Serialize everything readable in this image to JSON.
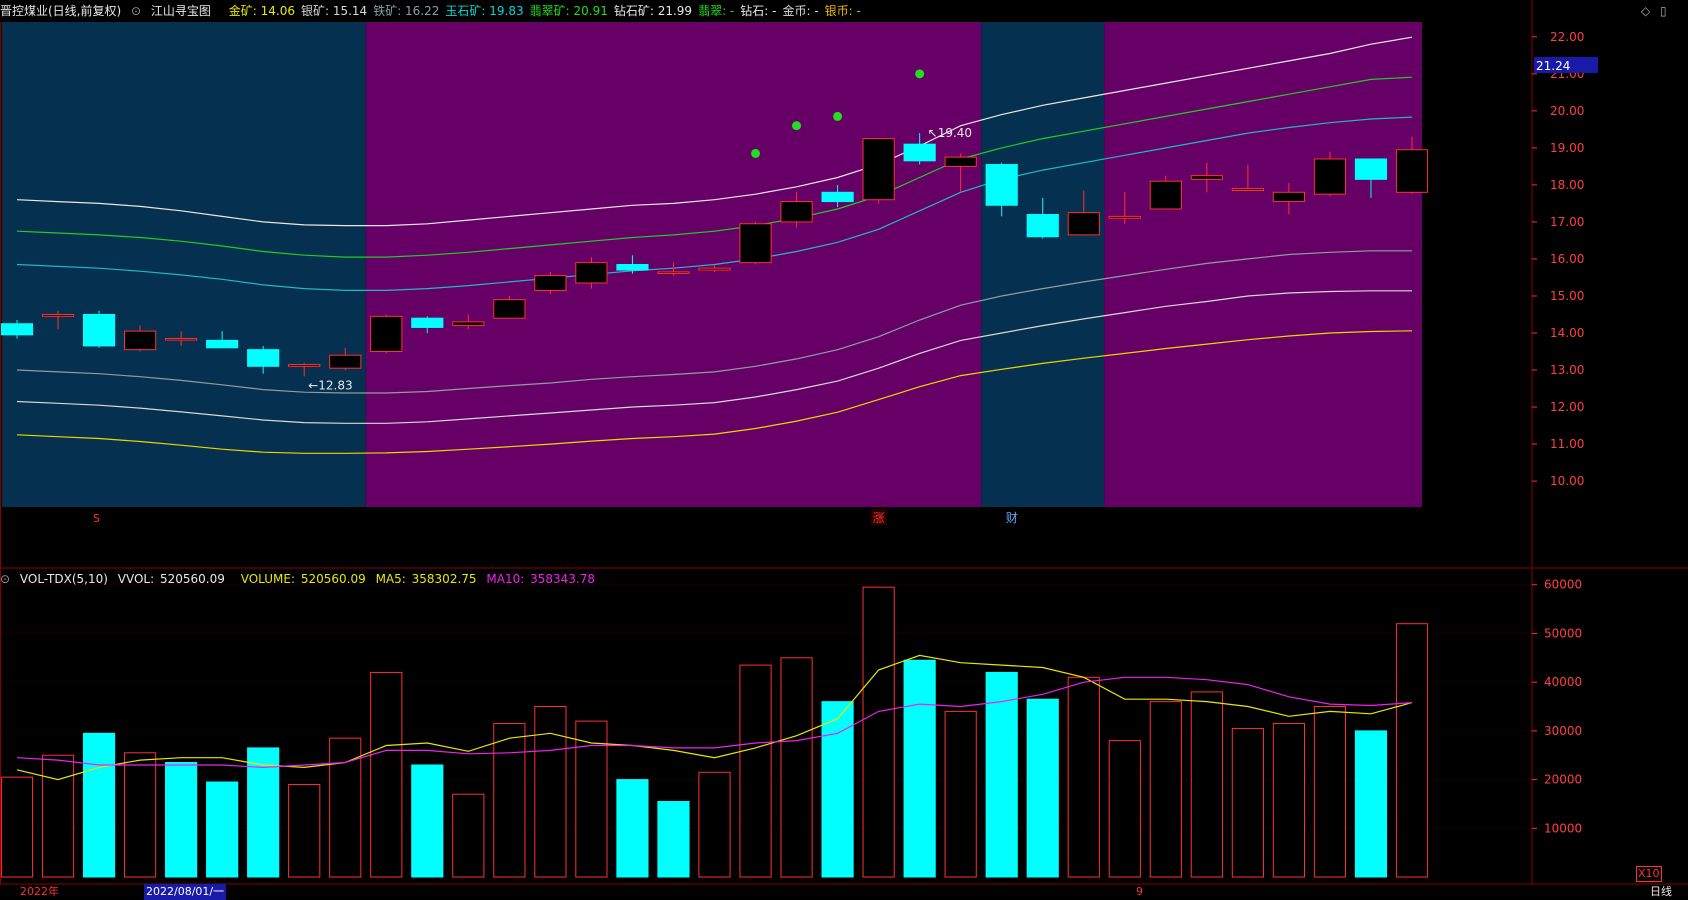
{
  "header": {
    "stock_name": "晋控煤业(日线,前复权)",
    "indicator_name": "江山寻宝图",
    "fields": [
      {
        "label": "金矿:",
        "value": "14.06",
        "color": "#e8e800"
      },
      {
        "label": "银矿:",
        "value": "15.14",
        "color": "#d8d8d8"
      },
      {
        "label": "铁矿:",
        "value": "16.22",
        "color": "#8aa0a0"
      },
      {
        "label": "玉石矿:",
        "value": "19.83",
        "color": "#00d8d8"
      },
      {
        "label": "翡翠矿:",
        "value": "20.91",
        "color": "#22dd22"
      },
      {
        "label": "钻石矿:",
        "value": "21.99",
        "color": "#e8e8e8"
      },
      {
        "label": "翡翠:",
        "value": "-",
        "color": "#22dd22"
      },
      {
        "label": "钻石:",
        "value": "-",
        "color": "#e8e8e8"
      },
      {
        "label": "金币:",
        "value": "-",
        "color": "#d8d8d8"
      },
      {
        "label": "银币:",
        "value": "-",
        "color": "#e8b800"
      }
    ]
  },
  "volume_header": {
    "indicator": "VOL-TDX(5,10)",
    "vvol_label": "VVOL:",
    "vvol_value": "520560.09",
    "volume_label": "VOLUME:",
    "volume_value": "520560.09",
    "ma5_label": "MA5:",
    "ma5_value": "358302.75",
    "ma10_label": "MA10:",
    "ma10_value": "358343.78"
  },
  "markers": {
    "low_label": "←12.83",
    "high_label": "↖19.40",
    "current_price_tag": "21.24",
    "event_s": "S",
    "event_zhang": "涨",
    "event_cai": "财"
  },
  "bottom": {
    "year": "2022年",
    "date_cursor": "2022/08/01/一",
    "month_mark": "9",
    "period": "日线",
    "zoom": "X10"
  },
  "colors": {
    "up": "#ff3030",
    "down": "#00ffff",
    "zone_blue": "#05304f",
    "zone_purple": "#660066",
    "axis_text": "#ff4040"
  },
  "chart_data": [
    {
      "type": "candlestick",
      "title": "晋控煤业(日线,前复权)",
      "y_axis_ticks": [
        "22.00",
        "21.00",
        "20.00",
        "19.00",
        "18.00",
        "17.00",
        "16.00",
        "15.00",
        "14.00",
        "13.00",
        "12.00",
        "11.00",
        "10.00"
      ],
      "ylim": [
        9.3,
        22.4
      ],
      "candles": [
        {
          "o": 14.25,
          "h": 14.35,
          "l": 13.85,
          "c": 13.95
        },
        {
          "o": 14.45,
          "h": 14.6,
          "l": 14.1,
          "c": 14.5
        },
        {
          "o": 14.5,
          "h": 14.6,
          "l": 13.6,
          "c": 13.65
        },
        {
          "o": 13.55,
          "h": 14.2,
          "l": 13.5,
          "c": 14.05
        },
        {
          "o": 13.85,
          "h": 14.05,
          "l": 13.65,
          "c": 13.85
        },
        {
          "o": 13.8,
          "h": 14.05,
          "l": 13.6,
          "c": 13.6
        },
        {
          "o": 13.55,
          "h": 13.65,
          "l": 12.9,
          "c": 13.1
        },
        {
          "o": 13.1,
          "h": 13.2,
          "l": 12.83,
          "c": 13.15
        },
        {
          "o": 13.05,
          "h": 13.6,
          "l": 13.0,
          "c": 13.4
        },
        {
          "o": 13.5,
          "h": 14.5,
          "l": 13.45,
          "c": 14.45
        },
        {
          "o": 14.4,
          "h": 14.45,
          "l": 14.0,
          "c": 14.15
        },
        {
          "o": 14.2,
          "h": 14.5,
          "l": 14.1,
          "c": 14.3
        },
        {
          "o": 14.4,
          "h": 15.0,
          "l": 14.4,
          "c": 14.9
        },
        {
          "o": 15.15,
          "h": 15.65,
          "l": 15.05,
          "c": 15.55
        },
        {
          "o": 15.35,
          "h": 16.05,
          "l": 15.2,
          "c": 15.9
        },
        {
          "o": 15.85,
          "h": 16.1,
          "l": 15.6,
          "c": 15.7
        },
        {
          "o": 15.65,
          "h": 15.9,
          "l": 15.55,
          "c": 15.65
        },
        {
          "o": 15.7,
          "h": 15.85,
          "l": 15.65,
          "c": 15.75
        },
        {
          "o": 15.9,
          "h": 17.0,
          "l": 15.85,
          "c": 16.95
        },
        {
          "o": 17.0,
          "h": 17.8,
          "l": 16.85,
          "c": 17.55
        },
        {
          "o": 17.8,
          "h": 18.0,
          "l": 17.4,
          "c": 17.55
        },
        {
          "o": 17.6,
          "h": 19.25,
          "l": 17.5,
          "c": 19.25
        },
        {
          "o": 19.1,
          "h": 19.4,
          "l": 18.55,
          "c": 18.65
        },
        {
          "o": 18.5,
          "h": 18.85,
          "l": 17.8,
          "c": 18.75
        },
        {
          "o": 18.55,
          "h": 18.6,
          "l": 17.15,
          "c": 17.45
        },
        {
          "o": 17.2,
          "h": 17.65,
          "l": 16.55,
          "c": 16.6
        },
        {
          "o": 16.65,
          "h": 17.85,
          "l": 16.65,
          "c": 17.25
        },
        {
          "o": 17.1,
          "h": 17.8,
          "l": 16.95,
          "c": 17.15
        },
        {
          "o": 17.35,
          "h": 18.25,
          "l": 17.35,
          "c": 18.1
        },
        {
          "o": 18.15,
          "h": 18.6,
          "l": 17.8,
          "c": 18.25
        },
        {
          "o": 17.85,
          "h": 18.55,
          "l": 17.85,
          "c": 17.9
        },
        {
          "o": 17.55,
          "h": 18.05,
          "l": 17.2,
          "c": 17.8
        },
        {
          "o": 17.75,
          "h": 18.9,
          "l": 17.7,
          "c": 18.7
        },
        {
          "o": 18.7,
          "h": 18.7,
          "l": 17.65,
          "c": 18.15
        },
        {
          "o": 17.8,
          "h": 19.3,
          "l": 17.75,
          "c": 18.95
        }
      ],
      "bands": [
        {
          "name": "钻石矿",
          "color": "#e8e8e8",
          "values": [
            17.6,
            17.55,
            17.5,
            17.42,
            17.3,
            17.15,
            17.0,
            16.92,
            16.9,
            16.9,
            16.95,
            17.05,
            17.15,
            17.25,
            17.35,
            17.45,
            17.5,
            17.6,
            17.75,
            17.95,
            18.2,
            18.55,
            19.05,
            19.6,
            19.9,
            20.15,
            20.35,
            20.55,
            20.75,
            20.95,
            21.15,
            21.35,
            21.55,
            21.8,
            21.99
          ]
        },
        {
          "name": "翡翠矿",
          "color": "#22cc22",
          "values": [
            16.75,
            16.7,
            16.65,
            16.58,
            16.48,
            16.35,
            16.2,
            16.1,
            16.05,
            16.05,
            16.1,
            16.18,
            16.28,
            16.38,
            16.48,
            16.58,
            16.65,
            16.75,
            16.9,
            17.1,
            17.35,
            17.7,
            18.2,
            18.7,
            19.0,
            19.25,
            19.45,
            19.65,
            19.85,
            20.05,
            20.25,
            20.45,
            20.65,
            20.85,
            20.91
          ]
        },
        {
          "name": "玉石矿",
          "color": "#20b8c8",
          "values": [
            15.85,
            15.8,
            15.75,
            15.67,
            15.57,
            15.45,
            15.3,
            15.2,
            15.15,
            15.15,
            15.2,
            15.28,
            15.38,
            15.48,
            15.58,
            15.68,
            15.75,
            15.85,
            16.0,
            16.2,
            16.45,
            16.8,
            17.3,
            17.8,
            18.15,
            18.4,
            18.6,
            18.8,
            19.0,
            19.2,
            19.4,
            19.55,
            19.68,
            19.78,
            19.83
          ]
        },
        {
          "name": "铁矿",
          "color": "#8aa0a0",
          "values": [
            13.0,
            12.95,
            12.9,
            12.82,
            12.72,
            12.6,
            12.47,
            12.4,
            12.38,
            12.38,
            12.42,
            12.5,
            12.58,
            12.65,
            12.75,
            12.82,
            12.88,
            12.95,
            13.1,
            13.3,
            13.55,
            13.9,
            14.35,
            14.75,
            15.0,
            15.2,
            15.38,
            15.55,
            15.72,
            15.88,
            16.0,
            16.12,
            16.18,
            16.22,
            16.22
          ]
        },
        {
          "name": "银矿",
          "color": "#d8d8d8",
          "values": [
            12.15,
            12.1,
            12.05,
            11.97,
            11.87,
            11.76,
            11.65,
            11.58,
            11.56,
            11.56,
            11.6,
            11.68,
            11.76,
            11.84,
            11.92,
            12.0,
            12.05,
            12.12,
            12.27,
            12.47,
            12.7,
            13.05,
            13.45,
            13.8,
            14.0,
            14.2,
            14.38,
            14.55,
            14.72,
            14.85,
            15.0,
            15.08,
            15.12,
            15.14,
            15.14
          ]
        },
        {
          "name": "金矿",
          "color": "#e8d800",
          "values": [
            11.25,
            11.2,
            11.15,
            11.07,
            10.97,
            10.86,
            10.78,
            10.75,
            10.75,
            10.76,
            10.8,
            10.86,
            10.93,
            11.0,
            11.08,
            11.15,
            11.2,
            11.27,
            11.42,
            11.62,
            11.86,
            12.2,
            12.55,
            12.85,
            13.02,
            13.18,
            13.32,
            13.45,
            13.58,
            13.7,
            13.82,
            13.92,
            14.0,
            14.04,
            14.06
          ]
        }
      ],
      "signal_dots": [
        {
          "index": 18,
          "value": 18.85
        },
        {
          "index": 19,
          "value": 19.6
        },
        {
          "index": 20,
          "value": 19.85
        },
        {
          "index": 22,
          "value": 21.0
        }
      ],
      "zones": [
        {
          "from": 0,
          "to": 9,
          "color": "blue"
        },
        {
          "from": 9,
          "to": 24,
          "color": "purple"
        },
        {
          "from": 24,
          "to": 27,
          "color": "blue"
        },
        {
          "from": 27,
          "to": 35,
          "color": "purple"
        }
      ]
    },
    {
      "type": "bar",
      "title": "VOL-TDX(5,10)",
      "y_axis_ticks": [
        "60000",
        "50000",
        "40000",
        "30000",
        "20000",
        "10000"
      ],
      "ylim": [
        0,
        62000
      ],
      "volumes": [
        20500,
        25000,
        29500,
        25500,
        23500,
        19500,
        26500,
        19000,
        28500,
        42000,
        23000,
        17000,
        31500,
        35000,
        32000,
        20000,
        15500,
        21500,
        43500,
        45000,
        36000,
        59500,
        44500,
        34000,
        42000,
        36500,
        41000,
        28000,
        36000,
        38000,
        30500,
        31500,
        35000,
        30000,
        52000
      ],
      "up": [
        true,
        true,
        false,
        true,
        false,
        false,
        false,
        true,
        true,
        true,
        false,
        true,
        true,
        true,
        true,
        false,
        false,
        true,
        true,
        true,
        false,
        true,
        false,
        true,
        false,
        false,
        true,
        true,
        true,
        true,
        true,
        true,
        true,
        false,
        true
      ],
      "ma5": [
        22000,
        20000,
        22500,
        24000,
        24500,
        24500,
        23000,
        22500,
        23500,
        27000,
        27500,
        25800,
        28500,
        29500,
        27500,
        27000,
        26000,
        24500,
        26500,
        29000,
        32500,
        42500,
        45500,
        44000,
        43500,
        43000,
        41000,
        36500,
        36500,
        36000,
        35000,
        33000,
        34000,
        33500,
        35800
      ],
      "ma10": [
        24500,
        24000,
        23000,
        23000,
        23000,
        23000,
        22500,
        23000,
        23500,
        26000,
        26000,
        25300,
        25500,
        26000,
        27000,
        27000,
        26500,
        26500,
        27500,
        28000,
        29500,
        34000,
        35500,
        35000,
        36000,
        37500,
        40000,
        41000,
        41000,
        40500,
        39500,
        37000,
        35500,
        35200,
        35800
      ]
    }
  ]
}
